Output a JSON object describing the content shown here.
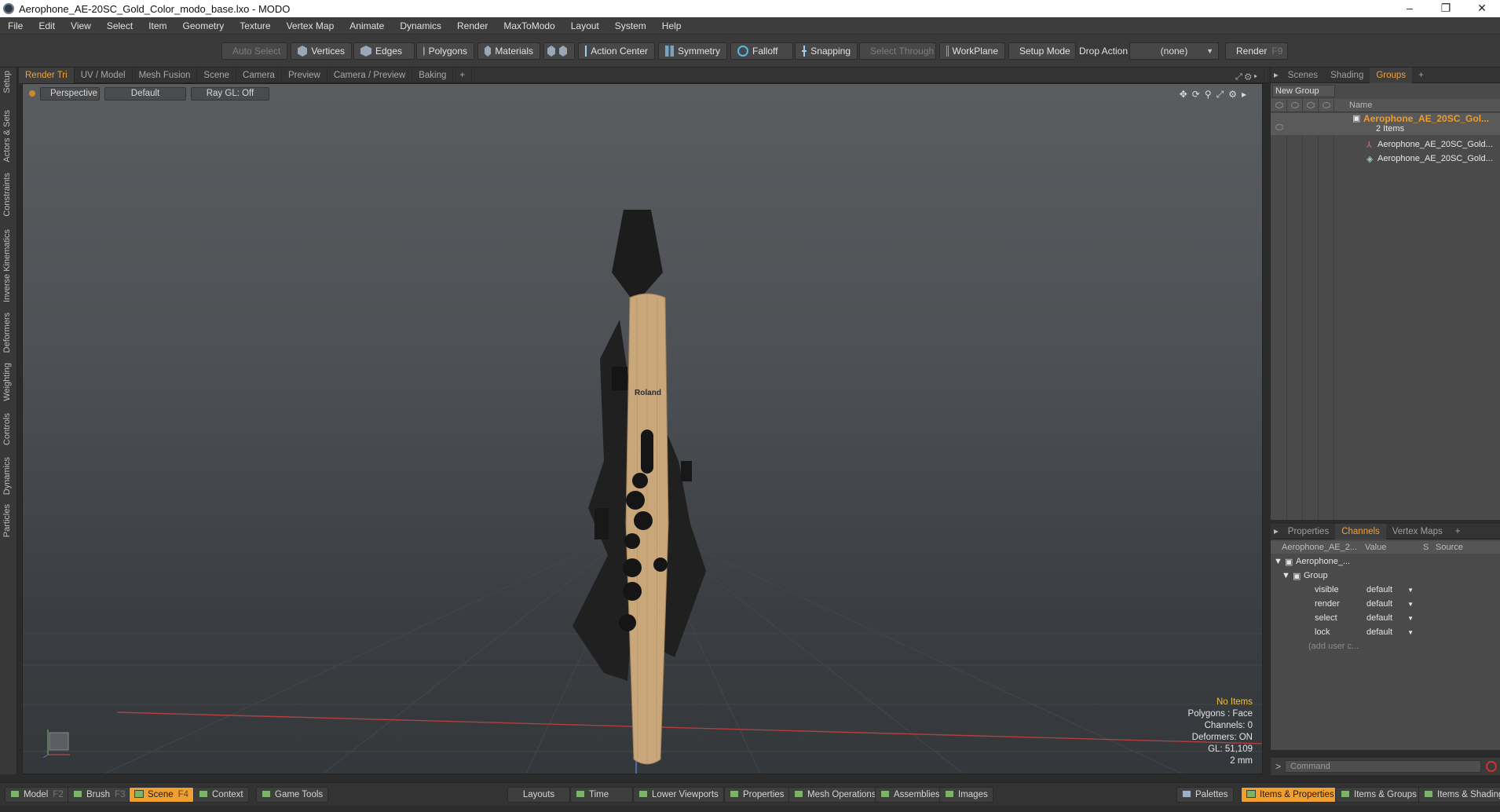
{
  "window": {
    "title": "Aerophone_AE-20SC_Gold_Color_modo_base.lxo - MODO",
    "minimize": "–",
    "restore": "❐",
    "close": "✕"
  },
  "menu": [
    "File",
    "Edit",
    "View",
    "Select",
    "Item",
    "Geometry",
    "Texture",
    "Vertex Map",
    "Animate",
    "Dynamics",
    "Render",
    "MaxToModo",
    "Layout",
    "System",
    "Help"
  ],
  "toolbar": {
    "auto_select": "Auto Select",
    "vertices": "Vertices",
    "edges": "Edges",
    "polygons": "Polygons",
    "materials": "Materials",
    "action_center": "Action Center",
    "symmetry": "Symmetry",
    "falloff": "Falloff",
    "snapping": "Snapping",
    "select_through": "Select Through",
    "workplane": "WorkPlane",
    "setup_mode": "Setup Mode",
    "drop_action_label": "Drop Action",
    "drop_action_value": "(none)",
    "render": "Render",
    "render_key": "F9"
  },
  "left_tabs": [
    "Setup",
    "Actors & Sets",
    "Constraints",
    "Inverse Kinematics",
    "Deformers",
    "Weighting",
    "Controls",
    "Dynamics",
    "Particles"
  ],
  "viewport_tabs": [
    "Render Tri",
    "UV / Model",
    "Mesh Fusion",
    "Scene",
    "Camera",
    "Preview",
    "Camera / Preview",
    "Baking",
    "+"
  ],
  "viewport": {
    "view": "Perspective",
    "shading": "Default",
    "raygl": "Ray GL: Off",
    "model_logo": "Roland",
    "info": {
      "items": "No Items",
      "polygons": "Polygons : Face",
      "channels": "Channels: 0",
      "deformers": "Deformers: ON",
      "gl": "GL: 51,109",
      "scale": "2 mm"
    }
  },
  "right_tabs": [
    "Scenes",
    "Shading",
    "Groups",
    "+"
  ],
  "groups": {
    "new_group": "New Group",
    "name_header": "Name",
    "root": "Aerophone_AE_20SC_Gol...",
    "count": "2 Items",
    "children": [
      "Aerophone_AE_20SC_Gold...",
      "Aerophone_AE_20SC_Gold..."
    ]
  },
  "props_tabs": [
    "Properties",
    "Channels",
    "Vertex Maps",
    "+"
  ],
  "channels": {
    "headers": {
      "name": "Aerophone_AE_2...",
      "value": "Value",
      "s": "S",
      "source": "Source"
    },
    "item": "Aerophone_...",
    "group": "Group",
    "rows": [
      {
        "key": "visible",
        "value": "default"
      },
      {
        "key": "render",
        "value": "default"
      },
      {
        "key": "select",
        "value": "default"
      },
      {
        "key": "lock",
        "value": "default"
      }
    ],
    "add_user": "(add user c..."
  },
  "command": {
    "placeholder": "Command"
  },
  "bottom": {
    "model": "Model",
    "model_key": "F2",
    "brush": "Brush",
    "brush_key": "F3",
    "scene": "Scene",
    "scene_key": "F4",
    "context": "Context",
    "game_tools": "Game Tools",
    "layouts": "Layouts",
    "time": "Time",
    "lower_viewports": "Lower Viewports",
    "properties": "Properties",
    "mesh_operations": "Mesh Operations",
    "assemblies": "Assemblies",
    "images": "Images",
    "palettes": "Palettes",
    "items_properties": "Items & Properties",
    "items_groups": "Items & Groups",
    "items_shading": "Items & Shading"
  },
  "colors": {
    "accent": "#f2a23a",
    "body_gold": "#c9a77a",
    "body_dark": "#1e1e1e"
  }
}
